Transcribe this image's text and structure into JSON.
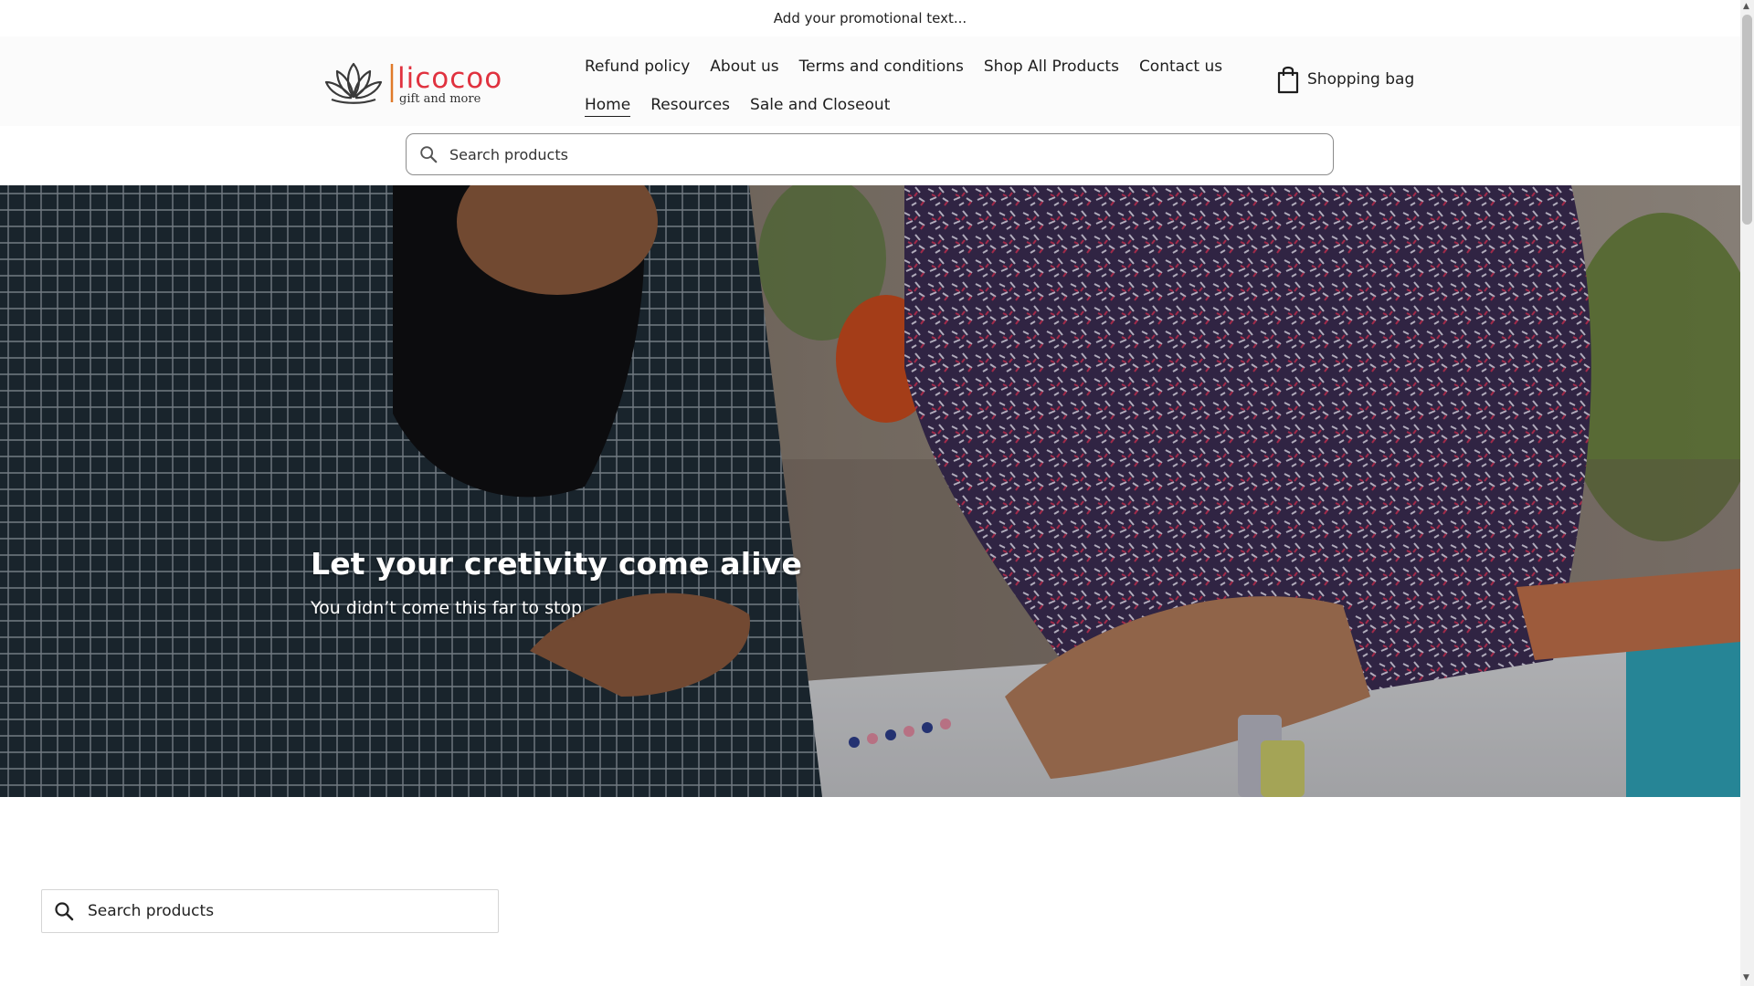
{
  "promo": {
    "text": "Add your promotional text..."
  },
  "logo": {
    "brand": "licocoo",
    "tagline": "gift and more"
  },
  "nav": {
    "row1": [
      "Refund policy",
      "About us",
      "Terms and conditions",
      "Shop All Products",
      "Contact us"
    ],
    "row2": [
      "Home",
      "Resources",
      "Sale and Closeout"
    ],
    "active": "Home"
  },
  "cart": {
    "label": "Shopping bag",
    "icon": "shopping-bag-icon"
  },
  "search": {
    "placeholder": "Search products"
  },
  "hero": {
    "title": "Let your cretivity come alive",
    "subtitle": "You didn’t come this far to stop"
  },
  "search_bottom": {
    "placeholder": "Search products"
  },
  "colors": {
    "brand": "#e0323f",
    "divider": "#e07a2a"
  }
}
